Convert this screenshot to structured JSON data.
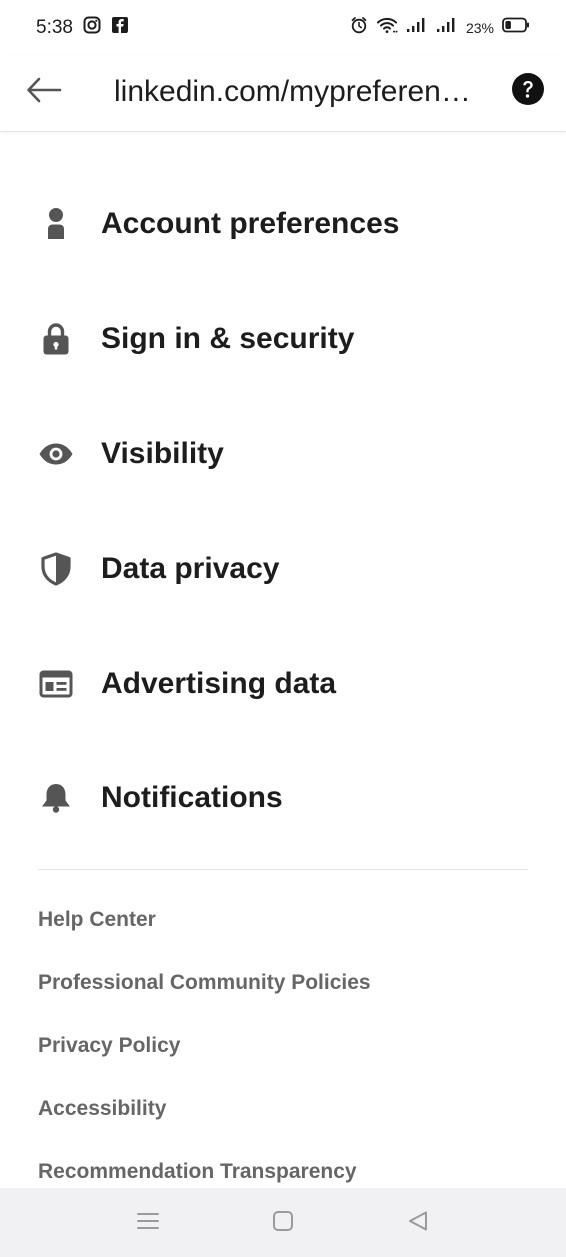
{
  "status_bar": {
    "time": "5:38",
    "battery_percent": "23%",
    "icons": [
      "instagram-icon",
      "facebook-icon",
      "alarm-icon",
      "wifi-icon",
      "signal-icon",
      "signal-icon",
      "battery-icon"
    ]
  },
  "app_bar": {
    "url": "linkedin.com/mypreferences/m/categories/account",
    "back_icon": "arrow-left-icon",
    "help_icon": "question-circle-icon"
  },
  "menu": {
    "items": [
      {
        "label": "Account preferences",
        "icon": "person-icon"
      },
      {
        "label": "Sign in & security",
        "icon": "lock-icon"
      },
      {
        "label": "Visibility",
        "icon": "eye-icon"
      },
      {
        "label": "Data privacy",
        "icon": "shield-icon"
      },
      {
        "label": "Advertising data",
        "icon": "newspaper-icon"
      },
      {
        "label": "Notifications",
        "icon": "bell-icon"
      }
    ]
  },
  "footer": {
    "links": [
      "Help Center",
      "Professional Community Policies",
      "Privacy Policy",
      "Accessibility",
      "Recommendation Transparency"
    ]
  },
  "nav_bar": {
    "icons": [
      "menu-icon",
      "home-square-icon",
      "back-triangle-icon"
    ]
  },
  "colors": {
    "text_primary": "#1d1d1d",
    "text_secondary": "#666666",
    "icon": "#555555",
    "nav_bg": "#f1f1f3",
    "divider": "#e3e3e3"
  }
}
